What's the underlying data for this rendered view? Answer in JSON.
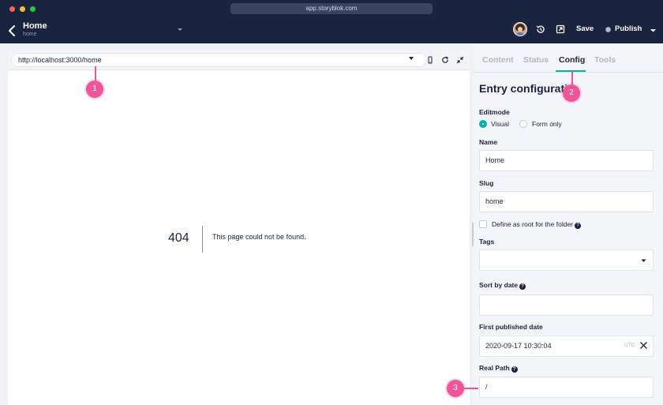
{
  "browser": {
    "address": "app.storyblok.com"
  },
  "header": {
    "story_title": "Home",
    "story_slug": "home",
    "save_label": "Save",
    "publish_label": "Publish",
    "icons": [
      "back-icon",
      "chevron-down-icon",
      "avatar",
      "history-icon",
      "open-external-icon",
      "chevron-down-icon"
    ]
  },
  "preview": {
    "url": "http://localhost:3000/home",
    "error_code": "404",
    "error_message": "This page could not be found.",
    "icons": [
      "mobile-device-icon",
      "reload-icon",
      "collapse-icon"
    ]
  },
  "panel": {
    "tabs": [
      {
        "label": "Content",
        "active": false
      },
      {
        "label": "Status",
        "active": false
      },
      {
        "label": "Config",
        "active": true
      },
      {
        "label": "Tools",
        "active": false
      }
    ],
    "section_title": "Entry configuratio",
    "editmode": {
      "label": "Editmode",
      "options": [
        "Visual",
        "Form only"
      ],
      "selected": "Visual"
    },
    "name": {
      "label": "Name",
      "value": "Home"
    },
    "slug": {
      "label": "Slug",
      "value": "home"
    },
    "root_folder": {
      "label": "Define as root for the folder",
      "checked": false
    },
    "tags": {
      "label": "Tags",
      "value": ""
    },
    "sort_by_date": {
      "label": "Sort by date",
      "value": ""
    },
    "first_published": {
      "label": "First published date",
      "value": "2020-09-17 10:30:04",
      "timezone": "UTC"
    },
    "real_path": {
      "label": "Real Path",
      "value": "/"
    }
  },
  "annotations": [
    "1",
    "2",
    "3"
  ],
  "colors": {
    "header_bg": "#1b243f",
    "accent": "#00b3b0",
    "marker": "#f0559a"
  }
}
